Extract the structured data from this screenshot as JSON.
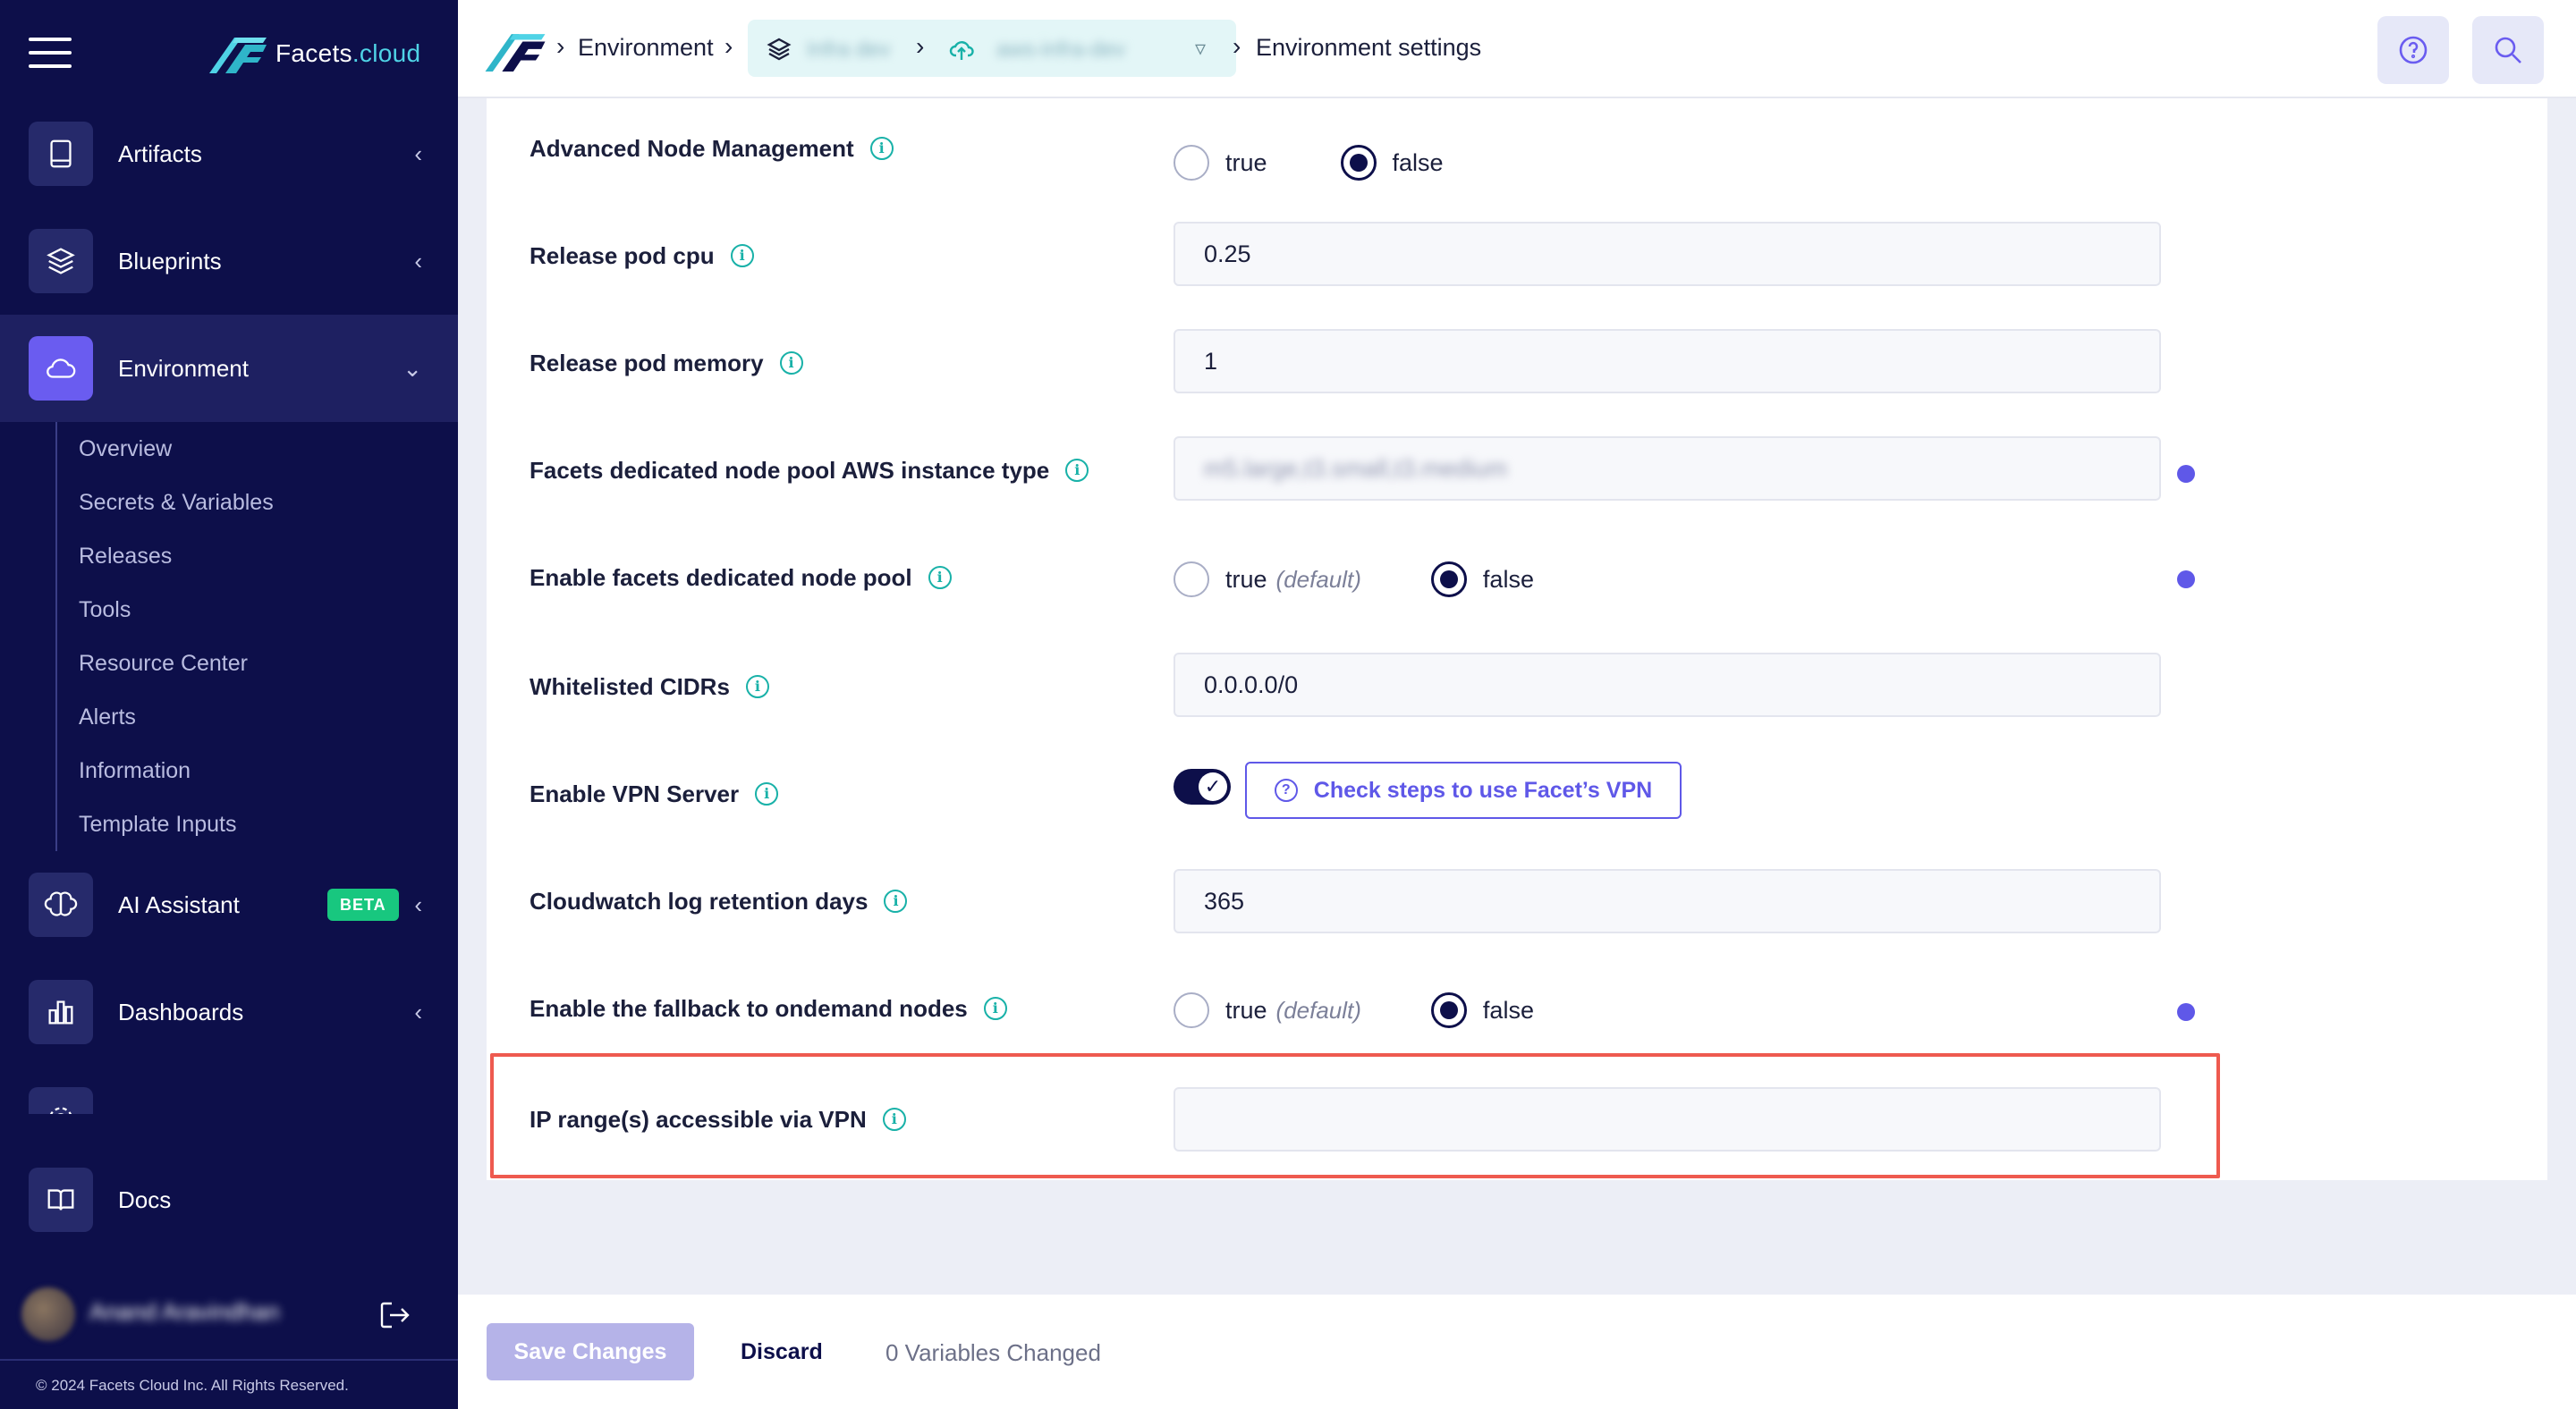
{
  "brand": {
    "name_part1": "Facets",
    "name_part2": ".cloud"
  },
  "sidebar": {
    "items": [
      {
        "label": "Artifacts",
        "chevron": "‹",
        "icon": "book-icon"
      },
      {
        "label": "Blueprints",
        "chevron": "‹",
        "icon": "layers-icon"
      },
      {
        "label": "Environment",
        "chevron": "⌄",
        "icon": "cloud-icon"
      },
      {
        "label": "AI Assistant",
        "chevron": "‹",
        "icon": "brain-icon",
        "badge": "BETA"
      },
      {
        "label": "Dashboards",
        "chevron": "‹",
        "icon": "bar-chart-icon"
      },
      {
        "label": "Docs",
        "icon": "open-book-icon"
      }
    ],
    "subitems": [
      "Overview",
      "Secrets & Variables",
      "Releases",
      "Tools",
      "Resource Center",
      "Alerts",
      "Information",
      "Template Inputs"
    ],
    "footer": "© 2024 Facets Cloud Inc. All Rights Reserved."
  },
  "header": {
    "crumb_environment": "Environment",
    "crumb_settings": "Environment settings",
    "pill_project": "Infra dev",
    "pill_env": "aws-infra-dev"
  },
  "form": {
    "rows": [
      {
        "label": "Advanced Node Management",
        "type": "radio",
        "true_label": "true",
        "false_label": "false",
        "selected": "false"
      },
      {
        "label": "Release pod cpu",
        "type": "text",
        "value": "0.25"
      },
      {
        "label": "Release pod memory",
        "type": "text",
        "value": "1"
      },
      {
        "label": "Facets dedicated node pool AWS instance type",
        "type": "text",
        "value": "m5.large,t3.small,t3.medium"
      },
      {
        "label": "Enable facets dedicated node pool",
        "type": "radio",
        "true_label": "true",
        "default_label": "(default)",
        "false_label": "false",
        "selected": "false"
      },
      {
        "label": "Whitelisted CIDRs",
        "type": "text",
        "value": "0.0.0.0/0"
      },
      {
        "label": "Enable VPN Server",
        "type": "toggle",
        "value": true,
        "button_label": "Check steps to use Facet’s VPN"
      },
      {
        "label": "Cloudwatch log retention days",
        "type": "text",
        "value": "365"
      },
      {
        "label": "Enable the fallback to ondemand nodes",
        "type": "radio",
        "true_label": "true",
        "default_label": "(default)",
        "false_label": "false",
        "selected": "false"
      },
      {
        "label": "IP range(s) accessible via VPN",
        "type": "text",
        "value": ""
      }
    ]
  },
  "footer": {
    "save_label": "Save Changes",
    "discard_label": "Discard",
    "changed_text": "0 Variables Changed"
  },
  "colors": {
    "sidebar_bg": "#0d0f4a",
    "accent": "#5f58e8",
    "teal": "#18b1a8",
    "highlight": "#ee5a4f"
  }
}
